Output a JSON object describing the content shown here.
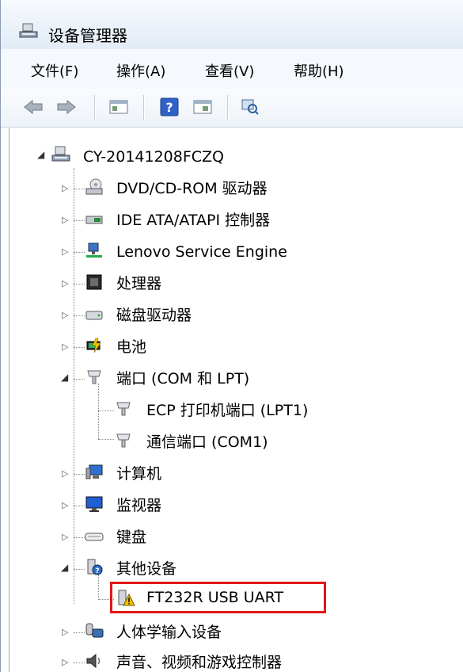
{
  "window": {
    "title": "设备管理器",
    "title_icon": "device-manager-icon"
  },
  "menu": [
    {
      "label": "文件(F)"
    },
    {
      "label": "操作(A)"
    },
    {
      "label": "查看(V)"
    },
    {
      "label": "帮助(H)"
    }
  ],
  "toolbar": {
    "buttons": [
      "back-arrow-icon",
      "forward-arrow-icon",
      "show-hide-tree-icon",
      "help-icon",
      "properties-pane-icon",
      "scan-hardware-icon"
    ]
  },
  "tree": {
    "root": {
      "label": "CY-20141208FCZQ",
      "icon": "computer-icon",
      "expanded": true
    },
    "items": [
      {
        "label": "DVD/CD-ROM 驱动器",
        "icon": "optical-drive-icon"
      },
      {
        "label": "IDE ATA/ATAPI 控制器",
        "icon": "ide-controller-icon"
      },
      {
        "label": "Lenovo Service Engine",
        "icon": "network-service-icon"
      },
      {
        "label": "处理器",
        "icon": "processor-icon"
      },
      {
        "label": "磁盘驱动器",
        "icon": "disk-drive-icon"
      },
      {
        "label": "电池",
        "icon": "battery-icon"
      },
      {
        "label": "端口 (COM 和 LPT)",
        "icon": "port-icon",
        "expanded": true,
        "children": [
          {
            "label": "ECP 打印机端口 (LPT1)",
            "icon": "port-icon"
          },
          {
            "label": "通信端口 (COM1)",
            "icon": "port-icon"
          }
        ]
      },
      {
        "label": "计算机",
        "icon": "computer-icon"
      },
      {
        "label": "监视器",
        "icon": "monitor-icon"
      },
      {
        "label": "键盘",
        "icon": "keyboard-icon"
      },
      {
        "label": "其他设备",
        "icon": "unknown-device-icon",
        "expanded": true,
        "children": [
          {
            "label": "FT232R USB UART",
            "icon": "warning-device-icon",
            "highlighted": true
          }
        ]
      },
      {
        "label": "人体学输入设备",
        "icon": "hid-icon"
      },
      {
        "label": "声音、视频和游戏控制器",
        "icon": "speaker-icon"
      }
    ]
  },
  "colors": {
    "highlight_border": "#e01818",
    "tree_line": "#888888",
    "warning": "#f0c000"
  }
}
